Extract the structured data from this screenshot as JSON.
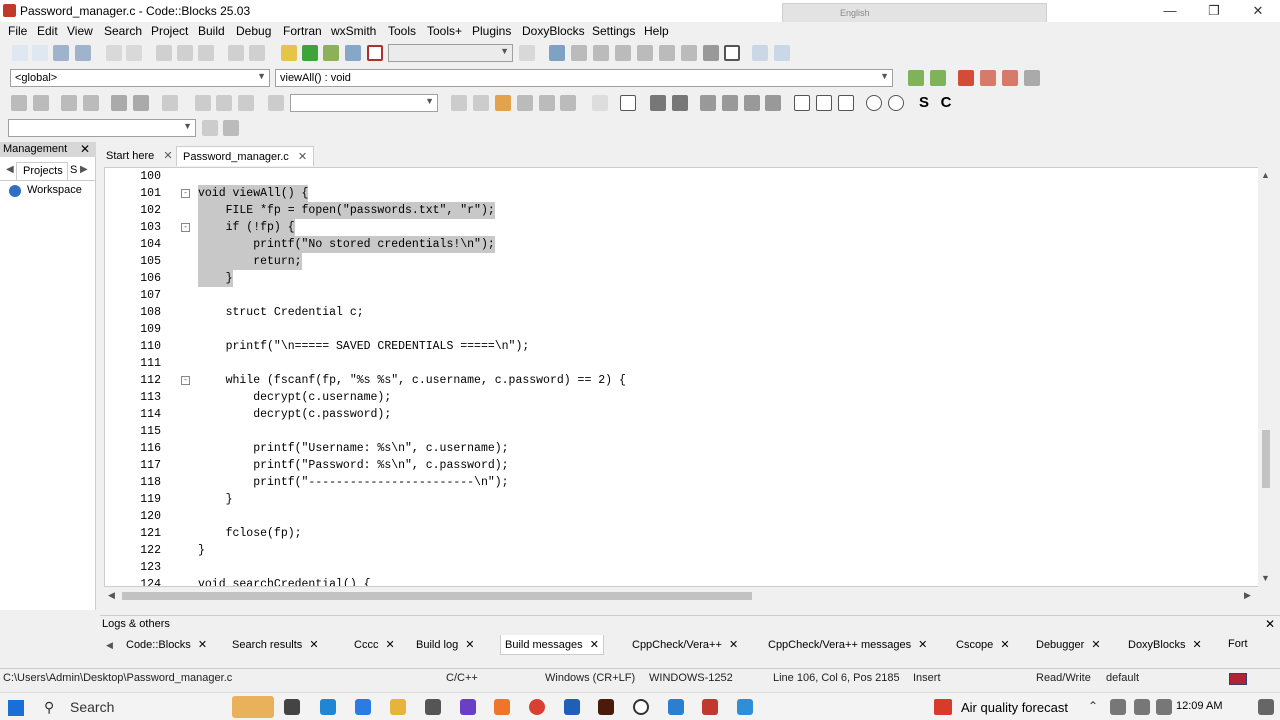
{
  "window": {
    "title": "Password_manager.c - Code::Blocks 25.03",
    "ime_lang": "English"
  },
  "menu": [
    "File",
    "Edit",
    "View",
    "Search",
    "Project",
    "Build",
    "Debug",
    "Fortran",
    "wxSmith",
    "Tools",
    "Tools+",
    "Plugins",
    "DoxyBlocks",
    "Settings",
    "Help"
  ],
  "scope": {
    "global": "<global>",
    "function": "viewAll() : void"
  },
  "management": {
    "title": "Management",
    "projects_tab": "Projects",
    "tab2": "S",
    "workspace": "Workspace"
  },
  "editor_tabs": [
    {
      "label": "Start here"
    },
    {
      "label": "Password_manager.c"
    }
  ],
  "code": [
    {
      "n": "100",
      "t": ""
    },
    {
      "n": "101",
      "t": "void viewAll() {"
    },
    {
      "n": "102",
      "t": "    FILE *fp = fopen(\"passwords.txt\", \"r\");"
    },
    {
      "n": "103",
      "t": "    if (!fp) {"
    },
    {
      "n": "104",
      "t": "        printf(\"No stored credentials!\\n\");"
    },
    {
      "n": "105",
      "t": "        return;"
    },
    {
      "n": "106",
      "t": "    }"
    },
    {
      "n": "107",
      "t": ""
    },
    {
      "n": "108",
      "t": "    struct Credential c;"
    },
    {
      "n": "109",
      "t": ""
    },
    {
      "n": "110",
      "t": "    printf(\"\\n===== SAVED CREDENTIALS =====\\n\");"
    },
    {
      "n": "111",
      "t": ""
    },
    {
      "n": "112",
      "t": "    while (fscanf(fp, \"%s %s\", c.username, c.password) == 2) {"
    },
    {
      "n": "113",
      "t": "        decrypt(c.username);"
    },
    {
      "n": "114",
      "t": "        decrypt(c.password);"
    },
    {
      "n": "115",
      "t": ""
    },
    {
      "n": "116",
      "t": "        printf(\"Username: %s\\n\", c.username);"
    },
    {
      "n": "117",
      "t": "        printf(\"Password: %s\\n\", c.password);"
    },
    {
      "n": "118",
      "t": "        printf(\"------------------------\\n\");"
    },
    {
      "n": "119",
      "t": "    }"
    },
    {
      "n": "120",
      "t": ""
    },
    {
      "n": "121",
      "t": "    fclose(fp);"
    },
    {
      "n": "122",
      "t": "}"
    },
    {
      "n": "123",
      "t": ""
    },
    {
      "n": "124",
      "t": "void searchCredential() {"
    }
  ],
  "logs": {
    "title": "Logs & others",
    "tabs": [
      "Code::Blocks",
      "Search results",
      "Cccc",
      "Build log",
      "Build messages",
      "CppCheck/Vera++",
      "CppCheck/Vera++ messages",
      "Cscope",
      "Debugger",
      "DoxyBlocks",
      "Fort"
    ]
  },
  "status": {
    "path": "C:\\Users\\Admin\\Desktop\\Password_manager.c",
    "lang": "C/C++",
    "eol": "Windows (CR+LF)",
    "enc": "WINDOWS-1252",
    "pos": "Line 106, Col 6, Pos 2185",
    "mode": "Insert",
    "rw": "Read/Write",
    "profile": "default"
  },
  "taskbar": {
    "search": "Search",
    "weather": "Air quality forecast",
    "time": "12:09 AM"
  }
}
